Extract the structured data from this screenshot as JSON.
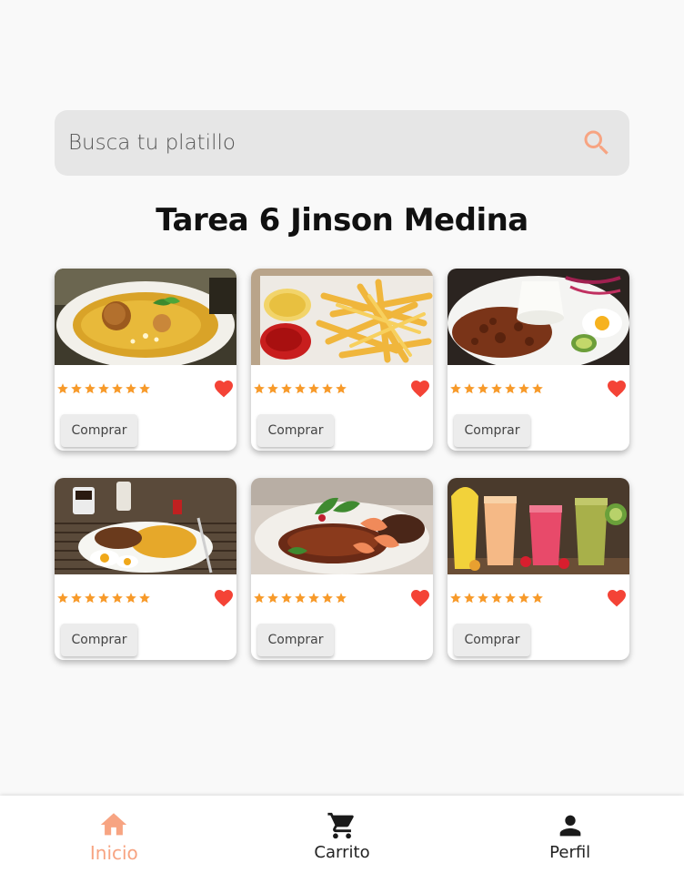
{
  "search": {
    "placeholder": "Busca tu platillo",
    "icon": "search-icon"
  },
  "page_title": "Tarea 6 Jinson Medina",
  "colors": {
    "accent": "#f7a482",
    "star": "#f79a2a",
    "heart": "#f44336"
  },
  "products": [
    {
      "image": "soup-dish-image",
      "rating": 7,
      "favorite": true,
      "buy_label": "Comprar"
    },
    {
      "image": "french-fries-image",
      "rating": 7,
      "favorite": true,
      "buy_label": "Comprar"
    },
    {
      "image": "rice-meat-plate-image",
      "rating": 7,
      "favorite": true,
      "buy_label": "Comprar"
    },
    {
      "image": "breakfast-plate-image",
      "rating": 7,
      "favorite": true,
      "buy_label": "Comprar"
    },
    {
      "image": "seafood-steak-image",
      "rating": 7,
      "favorite": true,
      "buy_label": "Comprar"
    },
    {
      "image": "fruit-smoothies-image",
      "rating": 7,
      "favorite": true,
      "buy_label": "Comprar"
    }
  ],
  "nav": {
    "items": [
      {
        "label": "Inicio",
        "icon": "home-icon",
        "active": true
      },
      {
        "label": "Carrito",
        "icon": "cart-icon",
        "active": false
      },
      {
        "label": "Perfil",
        "icon": "person-icon",
        "active": false
      }
    ]
  }
}
